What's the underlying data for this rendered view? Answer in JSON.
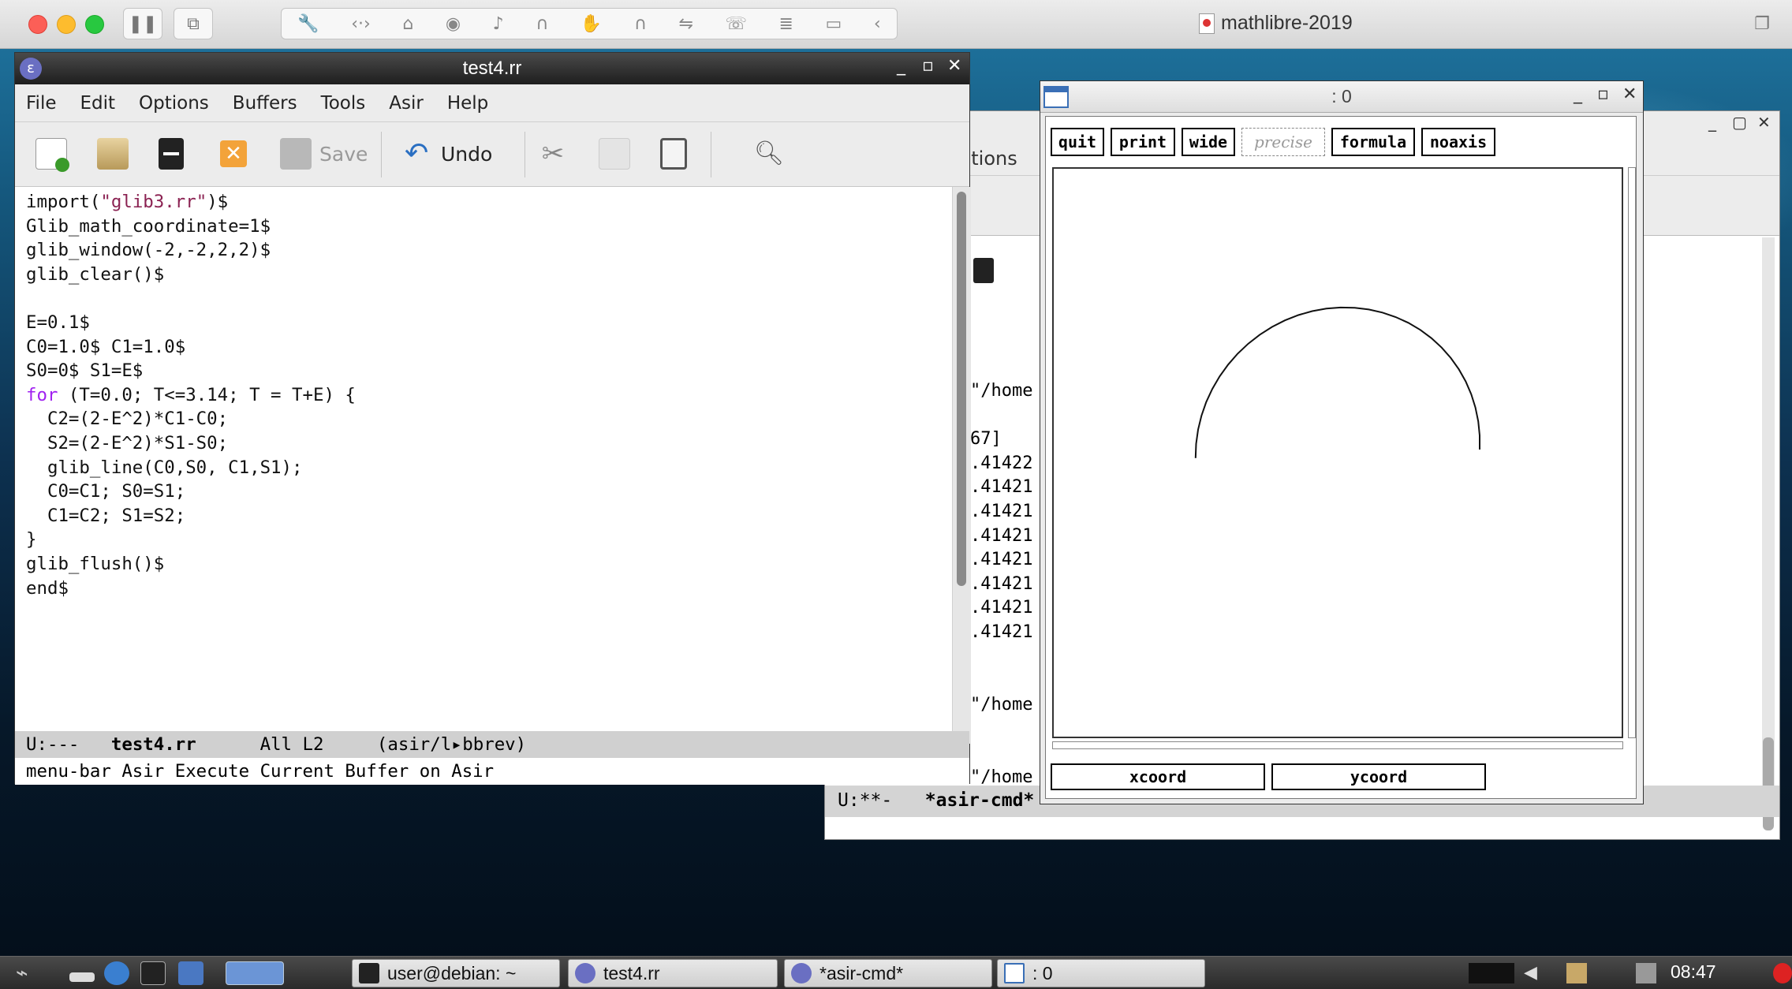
{
  "vm": {
    "title": "mathlibre-2019"
  },
  "emacs": {
    "title": "test4.rr",
    "menu": [
      "File",
      "Edit",
      "Options",
      "Buffers",
      "Tools",
      "Asir",
      "Help"
    ],
    "toolbar": {
      "save_label": "Save",
      "undo_label": "Undo"
    },
    "code": [
      "import(\"glib3.rr\")$",
      "Glib_math_coordinate=1$",
      "glib_window(-2,-2,2,2)$",
      "glib_clear()$",
      "",
      "E=0.1$",
      "C0=1.0$ C1=1.0$",
      "S0=0$ S1=E$",
      "for (T=0.0; T<=3.14; T = T+E) {",
      "  C2=(2-E^2)*C1-C0;",
      "  S2=(2-E^2)*S1-S0;",
      "  glib_line(C0,S0, C1,S1);",
      "  C0=C1; S0=S1;",
      "  C1=C2; S1=S2;",
      "}",
      "glib_flush()$",
      "end$"
    ],
    "modeline": {
      "status": "U:---",
      "buffer": "test4.rr",
      "position": "All L2",
      "mode": "(asir/l",
      "mode_tail": "bbrev)"
    },
    "echo": "menu-bar Asir Execute Current Buffer on Asir"
  },
  "bg_window": {
    "menu_fragment": "ptions",
    "lines": [
      "\"/home",
      "",
      "67]",
      ".41422",
      ".41421",
      ".41421",
      ".41421",
      ".41421",
      ".41421",
      ".41421",
      ".41421",
      "",
      "",
      "\"/home",
      "",
      "",
      "\"/home"
    ],
    "modeline": {
      "status": "U:**-",
      "buffer": "*asir-cmd*"
    }
  },
  "graph": {
    "title": ": 0",
    "buttons": [
      "quit",
      "print",
      "wide",
      "precise",
      "formula",
      "noaxis"
    ],
    "xcoord": "xcoord",
    "ycoord": "ycoord"
  },
  "taskbar": {
    "tasks": [
      "user@debian: ~",
      "test4.rr",
      "*asir-cmd*",
      ": 0"
    ],
    "clock": "08:47"
  }
}
